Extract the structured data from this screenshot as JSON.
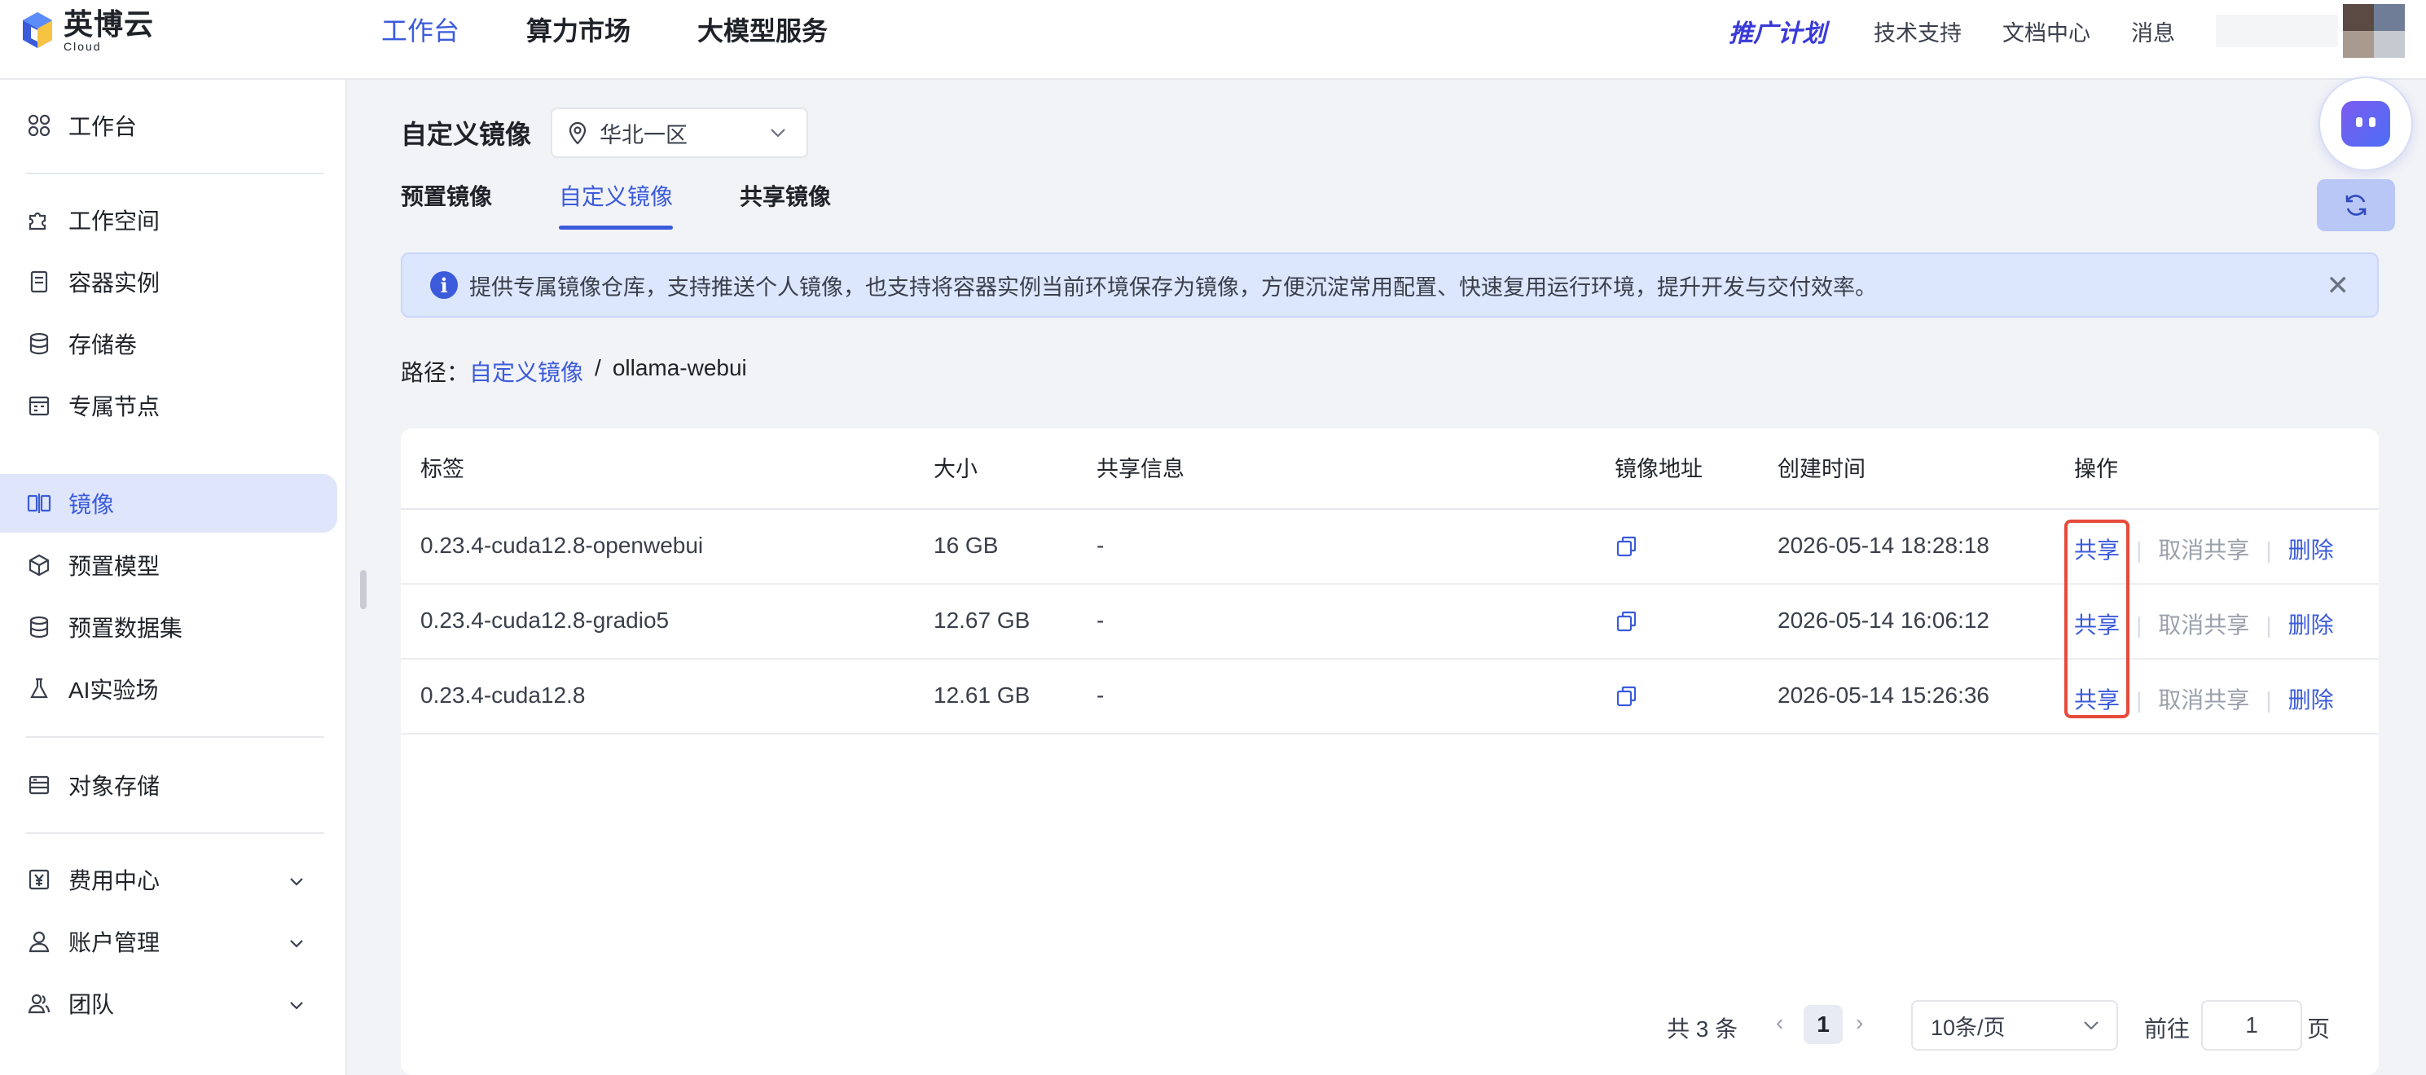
{
  "header": {
    "logo_name": "英博云",
    "logo_sub": "Cloud",
    "nav": [
      {
        "label": "工作台",
        "active": true
      },
      {
        "label": "算力市场",
        "active": false
      },
      {
        "label": "大模型服务",
        "active": false
      }
    ],
    "promo": "推广计划",
    "links": [
      "技术支持",
      "文档中心",
      "消息"
    ],
    "colors": {
      "accent": "#3b5bdb",
      "promo": "#3a3ad8"
    }
  },
  "sidebar": {
    "items": [
      {
        "label": "工作台",
        "icon": "grid-icon"
      },
      {
        "label": "工作空间",
        "icon": "puzzle-icon"
      },
      {
        "label": "容器实例",
        "icon": "container-icon"
      },
      {
        "label": "存储卷",
        "icon": "database-icon"
      },
      {
        "label": "专属节点",
        "icon": "calendar-icon"
      },
      {
        "label": "镜像",
        "icon": "mirror-icon",
        "active": true
      },
      {
        "label": "预置模型",
        "icon": "cube-icon"
      },
      {
        "label": "预置数据集",
        "icon": "database-icon"
      },
      {
        "label": "AI实验场",
        "icon": "flask-icon"
      },
      {
        "label": "对象存储",
        "icon": "storage-icon"
      },
      {
        "label": "费用中心",
        "icon": "yen-icon",
        "expandable": true
      },
      {
        "label": "账户管理",
        "icon": "user-icon",
        "expandable": true
      },
      {
        "label": "团队",
        "icon": "team-icon",
        "expandable": true
      }
    ]
  },
  "main": {
    "title": "自定义镜像",
    "region": "华北一区",
    "tabs": [
      {
        "label": "预置镜像",
        "active": false
      },
      {
        "label": "自定义镜像",
        "active": true
      },
      {
        "label": "共享镜像",
        "active": false
      }
    ],
    "notice": "提供专属镜像仓库，支持推送个人镜像，也支持将容器实例当前环境保存为镜像，方便沉淀常用配置、快速复用运行环境，提升开发与交付效率。",
    "breadcrumb": {
      "prefix": "路径：",
      "link": "自定义镜像",
      "sep": "/",
      "current": "ollama-webui"
    },
    "table": {
      "columns": [
        "标签",
        "大小",
        "共享信息",
        "镜像地址",
        "创建时间",
        "操作"
      ],
      "rows": [
        {
          "tag": "0.23.4-cuda12.8-openwebui",
          "size": "16 GB",
          "share": "-",
          "created": "2026-05-14 18:28:18"
        },
        {
          "tag": "0.23.4-cuda12.8-gradio5",
          "size": "12.67 GB",
          "share": "-",
          "created": "2026-05-14 16:06:12"
        },
        {
          "tag": "0.23.4-cuda12.8",
          "size": "12.61 GB",
          "share": "-",
          "created": "2026-05-14 15:26:36"
        }
      ],
      "actions": {
        "share": "共享",
        "cancel": "取消共享",
        "delete": "删除"
      }
    },
    "pagination": {
      "total": "共 3 条",
      "current": "1",
      "page_size": "10条/页",
      "goto_label": "前往",
      "goto_value": "1",
      "page_label": "页"
    }
  }
}
